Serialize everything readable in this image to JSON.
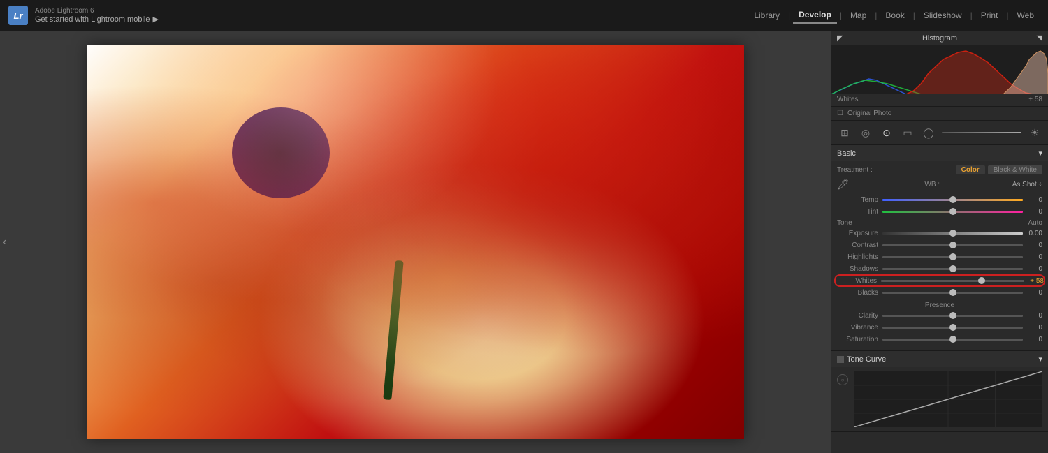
{
  "app": {
    "logo": "Lr",
    "adobe_title": "Adobe Lightroom 6",
    "subtitle": "Get started with Lightroom mobile",
    "subtitle_arrow": "▶"
  },
  "nav": {
    "items": [
      "Library",
      "Develop",
      "Map",
      "Book",
      "Slideshow",
      "Print",
      "Web"
    ],
    "active": "Develop",
    "separators": true
  },
  "histogram": {
    "title": "Histogram",
    "caption_left": "Whites",
    "caption_right": "+ 58",
    "triangle_left": "◤",
    "triangle_right": "◥"
  },
  "original_photo": {
    "checkbox": "☐",
    "label": "Original Photo"
  },
  "tools": {
    "icons": [
      "⊞",
      "◎",
      "⊙",
      "▭",
      "◯",
      "☀"
    ]
  },
  "basic_panel": {
    "title": "Basic",
    "collapse": "▾",
    "treatment_label": "Treatment :",
    "treatment_color": "Color",
    "treatment_bw": "Black & White",
    "wb_label": "WB :",
    "wb_value": "As Shot ÷",
    "tone_label": "Tone",
    "tone_auto": "Auto",
    "sliders": [
      {
        "label": "Temp",
        "value": "0",
        "percent": 50,
        "track": "temp"
      },
      {
        "label": "Tint",
        "value": "0",
        "percent": 50,
        "track": "tint"
      },
      {
        "label": "Exposure",
        "value": "0.00",
        "percent": 50,
        "track": "exposure"
      },
      {
        "label": "Contrast",
        "value": "0",
        "percent": 50,
        "track": "default"
      },
      {
        "label": "Highlights",
        "value": "0",
        "percent": 50,
        "track": "default"
      },
      {
        "label": "Shadows",
        "value": "0",
        "percent": 50,
        "track": "default"
      },
      {
        "label": "Whites",
        "value": "+ 58",
        "percent": 70,
        "track": "default",
        "highlighted": true
      },
      {
        "label": "Blacks",
        "value": "0",
        "percent": 50,
        "track": "default"
      }
    ],
    "presence_label": "Presence",
    "presence_sliders": [
      {
        "label": "Clarity",
        "value": "0",
        "percent": 50,
        "track": "default"
      },
      {
        "label": "Vibrance",
        "value": "0",
        "percent": 50,
        "track": "default"
      },
      {
        "label": "Saturation",
        "value": "0",
        "percent": 50,
        "track": "default"
      }
    ]
  },
  "tone_curve": {
    "title": "Tone Curve",
    "collapse": "▾"
  },
  "colors": {
    "accent": "#e8a030",
    "active_nav": "#dddddd",
    "highlight_border": "#cc2020",
    "panel_bg": "#2a2a2a",
    "section_header_bg": "#2e2e2e"
  }
}
